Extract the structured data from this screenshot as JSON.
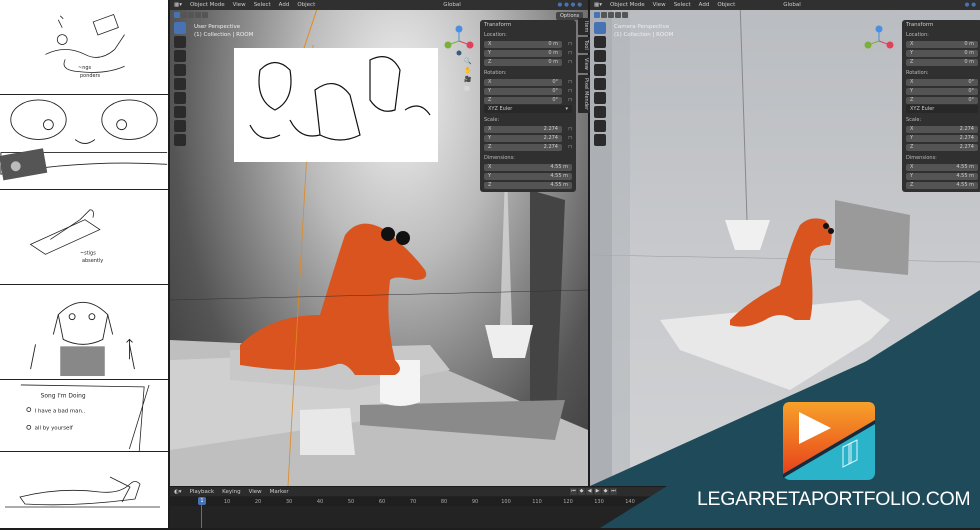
{
  "storyboard": {
    "panels": [
      "sketch-1",
      "sketch-2",
      "sketch-3",
      "sketch-4",
      "sketch-5",
      "sketch-6"
    ],
    "panel5_text": [
      "Song I'm Doing",
      "I have a bad man..",
      "all by yourself"
    ]
  },
  "viewport_left": {
    "header": {
      "mode": "Object Mode",
      "menus": [
        "View",
        "Select",
        "Add",
        "Object"
      ],
      "orientation": "Global"
    },
    "options_label": "Options",
    "perspective": "User Perspective",
    "collection": "(1) Collection | ROOM"
  },
  "viewport_right": {
    "header": {
      "mode": "Object Mode",
      "menus": [
        "View",
        "Select",
        "Add",
        "Object"
      ],
      "orientation": "Global"
    },
    "perspective": "Camera Perspective",
    "collection": "(1) Collection | ROOM"
  },
  "transform": {
    "title": "Transform",
    "location_label": "Location:",
    "location": [
      {
        "axis": "X",
        "value": "0 m"
      },
      {
        "axis": "Y",
        "value": "0 m"
      },
      {
        "axis": "Z",
        "value": "0 m"
      }
    ],
    "rotation_label": "Rotation:",
    "rotation": [
      {
        "axis": "X",
        "value": "0°"
      },
      {
        "axis": "Y",
        "value": "0°"
      },
      {
        "axis": "Z",
        "value": "0°"
      }
    ],
    "rotation_mode": "XYZ Euler",
    "scale_label": "Scale:",
    "scale": [
      {
        "axis": "X",
        "value": "2.274"
      },
      {
        "axis": "Y",
        "value": "2.274"
      },
      {
        "axis": "Z",
        "value": "2.274"
      }
    ],
    "dimensions_label": "Dimensions:",
    "dimensions": [
      {
        "axis": "X",
        "value": "4.55 m"
      },
      {
        "axis": "Y",
        "value": "4.55 m"
      },
      {
        "axis": "Z",
        "value": "4.55 m"
      }
    ]
  },
  "sidebar_tabs": [
    "Item",
    "Tool",
    "View",
    "Pixel Mender"
  ],
  "timeline": {
    "menus": [
      "Playback",
      "Keying",
      "View",
      "Marker"
    ],
    "current_frame": "1",
    "ticks": [
      "10",
      "20",
      "30",
      "40",
      "50",
      "60",
      "70",
      "80",
      "90",
      "100",
      "110",
      "120",
      "130",
      "140"
    ]
  },
  "brand": {
    "text": "LEGARRETAPORTFOLIO.COM",
    "colors": {
      "orange": "#f26a1b",
      "teal": "#1e4a5a",
      "cyan": "#2bb3c9"
    }
  },
  "colors": {
    "accent": "#4772b3",
    "character": "#d9541f",
    "header": "#303030"
  }
}
